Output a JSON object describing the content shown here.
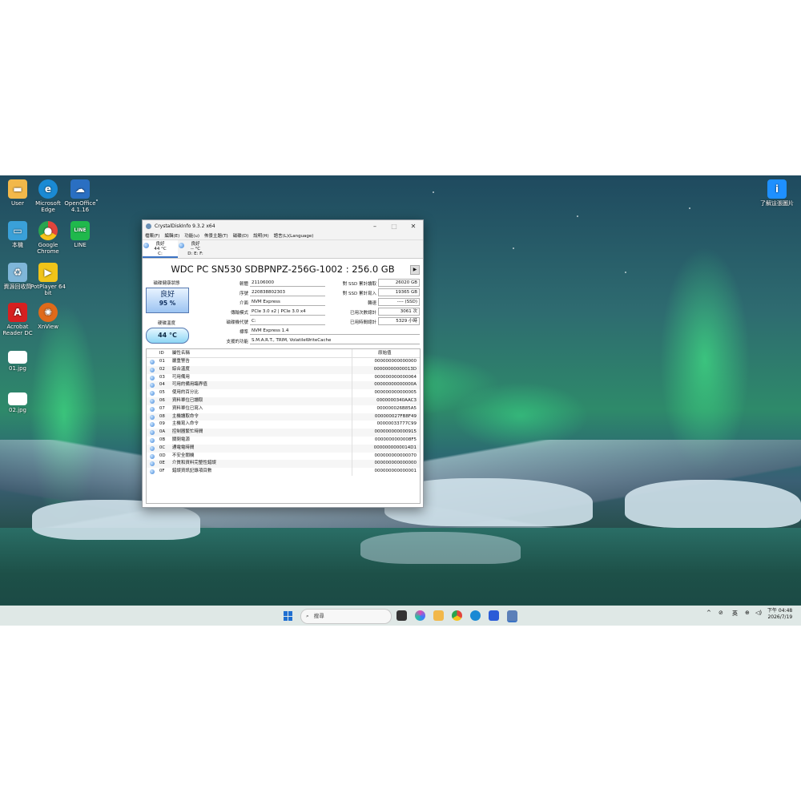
{
  "desktop": {
    "icons": [
      {
        "label": "User",
        "icon": "folder-icon",
        "color": "#f2b84a"
      },
      {
        "label": "Microsoft Edge",
        "icon": "edge-icon",
        "color": "#1a8ad4"
      },
      {
        "label": "OpenOffice 4.1.16",
        "icon": "openoffice-icon",
        "color": "#2a6fc2"
      },
      {
        "label": "本機",
        "icon": "computer-icon",
        "color": "#3aa0d8"
      },
      {
        "label": "Google Chrome",
        "icon": "chrome-icon",
        "color": "#e2453c"
      },
      {
        "label": "LINE",
        "icon": "line-icon",
        "color": "#20b84c"
      },
      {
        "label": "資源回收筒",
        "icon": "recycle-bin-icon",
        "color": "#7fb6d9"
      },
      {
        "label": "PotPlayer 64 bit",
        "icon": "potplayer-icon",
        "color": "#f0c419"
      },
      {
        "label": "Acrobat Reader DC",
        "icon": "acrobat-icon",
        "color": "#d62020"
      },
      {
        "label": "XnView",
        "icon": "xnview-icon",
        "color": "#e06a1a"
      },
      {
        "label": "01.jpg",
        "icon": "image-file-icon",
        "color": "#ffffff"
      },
      {
        "label": "02.jpg",
        "icon": "image-file-icon",
        "color": "#ffffff"
      }
    ],
    "spotlight": {
      "label": "了解這張圖片",
      "icon": "spotlight-icon",
      "color": "#1e90ff"
    }
  },
  "window": {
    "title": "CrystalDiskInfo 9.3.2 x64",
    "menu": [
      "檔案(F)",
      "編輯(E)",
      "功能(u)",
      "佈景主題(T)",
      "磁碟(D)",
      "說明(H)",
      "語言(L)(Language)"
    ],
    "disk_tabs": [
      {
        "status": "良好",
        "temp": "44 °C",
        "drive": "C:"
      },
      {
        "status": "良好",
        "temp": "-- °C",
        "drive": "D: E: F:"
      }
    ],
    "model": "WDC PC SN530 SDBPNPZ-256G-1002 : 256.0 GB",
    "health_label": "磁碟健康狀態",
    "health_status": "良好",
    "health_pct": "95 %",
    "temp_label": "硬碟溫度",
    "temp_value": "44 °C",
    "info": {
      "firmware_label": "韌體",
      "firmware": "21106000",
      "serial_label": "序號",
      "serial": "220838802303",
      "interface_label": "介面",
      "interface": "NVM Express",
      "transfer_label": "傳輸模式",
      "transfer": "PCIe 3.0 x2 | PCIe 3.0 x4",
      "drive_letter_label": "磁碟機代號",
      "drive_letter": "C:",
      "standard_label": "標準",
      "standard": "NVM Express 1.4",
      "features_label": "支援的功能",
      "features": "S.M.A.R.T., TRIM, VolatileWriteCache",
      "host_reads_label": "對 SSD 累計讀取",
      "host_reads": "26020 GB",
      "host_writes_label": "對 SSD 累計寫入",
      "host_writes": "19365 GB",
      "rotation_label": "轉速",
      "rotation": "---- (SSD)",
      "power_count_label": "已用次數總計",
      "power_count": "3061 次",
      "power_hours_label": "已用時間總計",
      "power_hours": "5329 小時"
    },
    "smart": {
      "headers": {
        "id": "ID",
        "name": "屬性名稱",
        "raw": "原始值"
      },
      "rows": [
        {
          "id": "01",
          "name": "嚴重警告",
          "raw": "000000000000000"
        },
        {
          "id": "02",
          "name": "綜合溫度",
          "raw": "00000000000013D"
        },
        {
          "id": "03",
          "name": "可用備用",
          "raw": "000000000000064"
        },
        {
          "id": "04",
          "name": "可用的備用臨界值",
          "raw": "00000000000000A"
        },
        {
          "id": "05",
          "name": "使用的百分比",
          "raw": "000000000000005"
        },
        {
          "id": "06",
          "name": "資料單位已讀取",
          "raw": "0000000340AAC3"
        },
        {
          "id": "07",
          "name": "資料單位已寫入",
          "raw": "000000026B85A5"
        },
        {
          "id": "08",
          "name": "主機讀取命令",
          "raw": "000000027FB8F49"
        },
        {
          "id": "09",
          "name": "主機寫入命令",
          "raw": "00000033777C99"
        },
        {
          "id": "0A",
          "name": "控制器繁忙時間",
          "raw": "000000000000915"
        },
        {
          "id": "0B",
          "name": "關閉電源",
          "raw": "0000000000008F5"
        },
        {
          "id": "0C",
          "name": "通電電時間",
          "raw": "0000000000014D1"
        },
        {
          "id": "0D",
          "name": "不安全關機",
          "raw": "000000000000070"
        },
        {
          "id": "0E",
          "name": "介質和資料完整性錯誤",
          "raw": "000000000000000"
        },
        {
          "id": "0F",
          "name": "錯誤資訊記錄項目數",
          "raw": "000000000000001"
        }
      ]
    }
  },
  "taskbar": {
    "search_placeholder": "搜尋",
    "tray": {
      "chevron": "^",
      "ime": "英",
      "language_icon": "globe-icon",
      "volume_icon": "speaker-icon",
      "network_icon": "network-off-icon"
    },
    "time": "下午 04:48",
    "date": "2026/7/19"
  }
}
